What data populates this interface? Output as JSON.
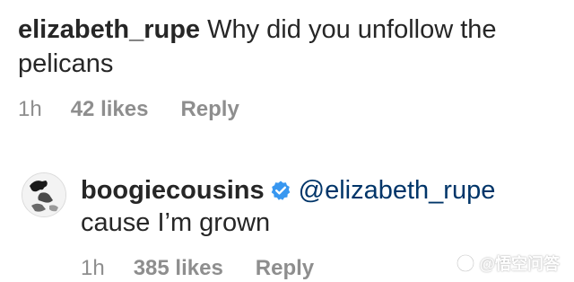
{
  "comment": {
    "username": "elizabeth_rupe",
    "text": "Why did you unfollow the pelicans",
    "time": "1h",
    "likes": "42 likes",
    "reply_label": "Reply"
  },
  "reply": {
    "username": "boogiecousins",
    "verified": true,
    "mention": "@elizabeth_rupe",
    "text": "cause I’m grown",
    "time": "1h",
    "likes": "385 likes",
    "reply_label": "Reply"
  },
  "colors": {
    "text": "#262626",
    "meta": "#8e8e8e",
    "verified": "#3897f0",
    "mention": "#003569"
  },
  "watermark": {
    "icon": "logo-icon",
    "text": "@悟空问答"
  }
}
